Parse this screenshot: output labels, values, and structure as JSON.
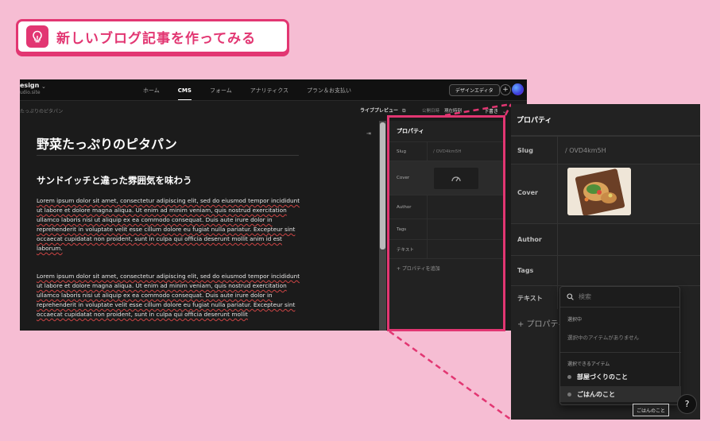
{
  "header": {
    "title": "新しいブログ記事を作ってみる"
  },
  "site": {
    "name": "esign",
    "url": "udio.site"
  },
  "nav": {
    "items": [
      "ホーム",
      "CMS",
      "フォーム",
      "アナリティクス",
      "プラン＆お支払い"
    ],
    "active": "CMS"
  },
  "toolbar": {
    "design_editor": "デザインエディタ",
    "plus": "+"
  },
  "subbar": {
    "breadcrumb": "たっぷりのピタパン",
    "live_preview": "ライブプレビュー",
    "publish_label": "公開日時",
    "publish_value": "現在時刻",
    "draft": "下書き"
  },
  "article": {
    "title": "野菜たっぷりのピタパン",
    "subtitle": "サンドイッチと違った雰囲気を味わう",
    "paragraphs": [
      "Lorem ipsum dolor sit amet, consectetur adipiscing elit, sed do eiusmod tempor incididunt ut labore et dolore magna aliqua. Ut enim ad minim veniam, quis nostrud exercitation ullamco laboris nisi ut aliquip ex ea commodo consequat. Duis aute irure dolor in reprehenderit in voluptate velit esse cillum dolore eu fugiat nulla pariatur. Excepteur sint occaecat cupidatat non proident, sunt in culpa qui officia deserunt mollit anim id est laborum.",
      "Lorem ipsum dolor sit amet, consectetur adipiscing elit, sed do eiusmod tempor incididunt ut labore et dolore magna aliqua. Ut enim ad minim veniam, quis nostrud exercitation ullamco laboris nisi ut aliquip ex ea commodo consequat. Duis aute irure dolor in reprehenderit in voluptate velit esse cillum dolore eu fugiat nulla pariatur. Excepteur sint occaecat cupidatat non proident, sunt in culpa qui officia deserunt mollit"
    ]
  },
  "properties": {
    "title": "プロパティ",
    "rows": [
      {
        "label": "Slug",
        "value": "/ OVD4km5H"
      },
      {
        "label": "Cover",
        "value": ""
      },
      {
        "label": "Author",
        "value": ""
      },
      {
        "label": "Tags",
        "value": ""
      },
      {
        "label": "テキスト",
        "value": ""
      }
    ],
    "add": "+ プロパティを追加",
    "add_truncated": "+ プロパティ"
  },
  "dropdown": {
    "search_placeholder": "検索",
    "selected_header": "選択中",
    "selected_empty": "選択中のアイテムがありません",
    "available_header": "選択できるアイテム",
    "items": [
      "部屋づくりのこと",
      "ごはんのこと"
    ]
  },
  "help": {
    "label": "?"
  },
  "tooltip": {
    "text": "ごはんのこと"
  },
  "colors": {
    "accent": "#e23672",
    "background": "#f6bdd3",
    "panel": "#222222"
  }
}
